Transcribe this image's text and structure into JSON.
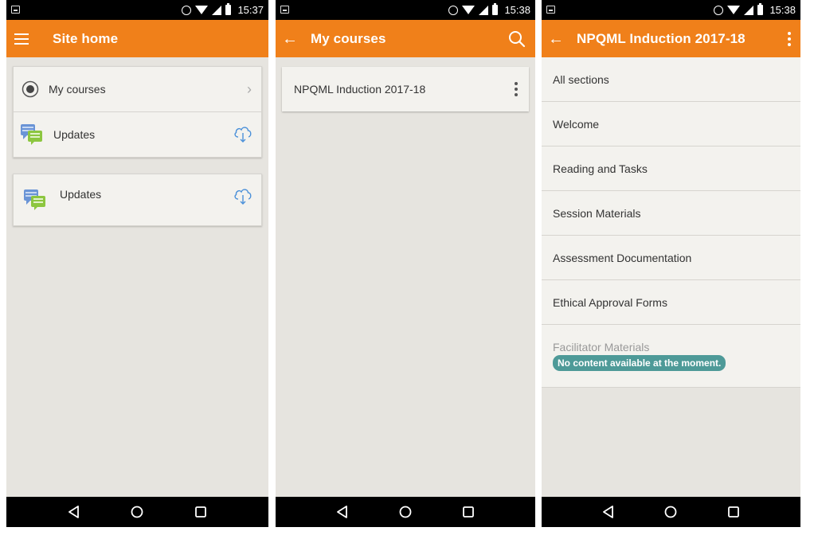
{
  "status_times": {
    "panel1": "15:37",
    "panel2": "15:38",
    "panel3": "15:38"
  },
  "panel1": {
    "appbar_title": "Site home",
    "menu_card": {
      "my_courses_label": "My courses",
      "updates_label": "Updates"
    },
    "updates_card": {
      "label": "Updates"
    }
  },
  "panel2": {
    "appbar_title": "My courses",
    "course_title": "NPQML Induction 2017-18"
  },
  "panel3": {
    "appbar_title": "NPQML Induction 2017-18",
    "sections": [
      "All sections",
      "Welcome",
      "Reading and Tasks",
      "Session Materials",
      "Assessment Documentation",
      "Ethical Approval Forms"
    ],
    "disabled_section": {
      "label": "Facilitator Materials",
      "badge": "No content available at the moment."
    }
  },
  "colors": {
    "appbar": "#f0801a",
    "background": "#e6e4df",
    "card": "#f3f2ee",
    "badge": "#4e9a98",
    "accent_blue": "#4a90d9"
  },
  "icons": {
    "menu": "hamburger-icon",
    "back": "back-arrow-icon",
    "search": "search-icon",
    "more": "more-vert-icon",
    "courses": "radio-target-icon",
    "updates": "chat-bubbles-icon",
    "download": "cloud-download-icon"
  }
}
